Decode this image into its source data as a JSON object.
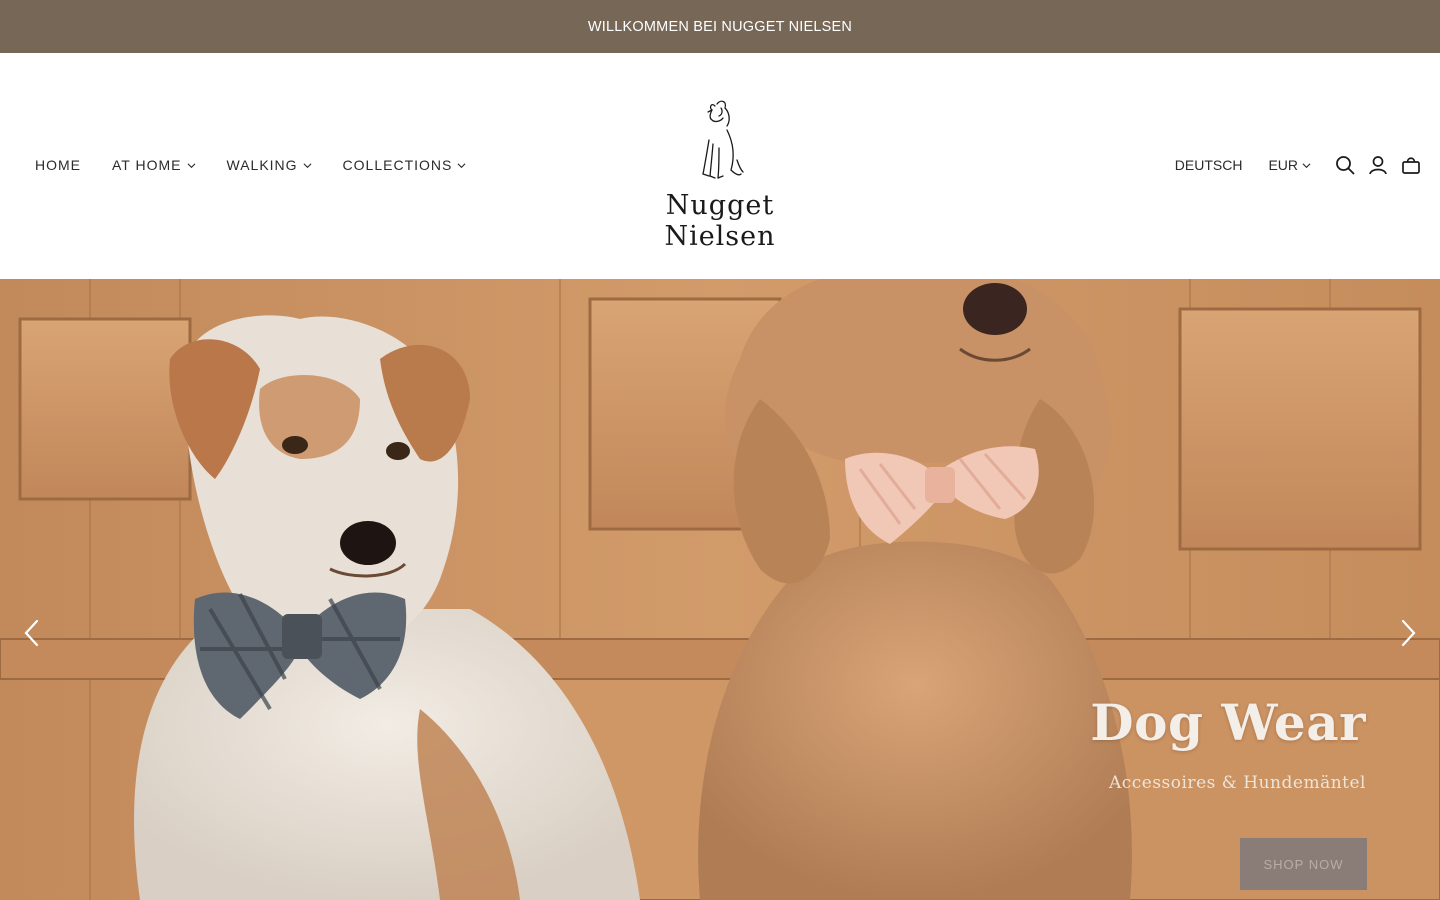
{
  "announcement": {
    "text": "WILLKOMMEN BEI NUGGET NIELSEN"
  },
  "brand": {
    "name": "Nugget Nielsen",
    "logo_icon": "dog-sketch-icon"
  },
  "nav": {
    "items": [
      {
        "label": "HOME",
        "has_dropdown": false
      },
      {
        "label": "AT HOME",
        "has_dropdown": true
      },
      {
        "label": "WALKING",
        "has_dropdown": true
      },
      {
        "label": "COLLECTIONS",
        "has_dropdown": true
      }
    ]
  },
  "utility": {
    "language": "DEUTSCH",
    "currency": "EUR",
    "icons": [
      "search-icon",
      "account-icon",
      "cart-icon"
    ]
  },
  "hero": {
    "title": "Dog Wear",
    "subtitle": "Accessoires & Hundemäntel",
    "cta": "SHOP NOW",
    "prev_icon": "chevron-left-icon",
    "next_icon": "chevron-right-icon"
  },
  "colors": {
    "announcement_bg": "#776757",
    "button_bg": "#8a7c77",
    "wood": "#c98f5e"
  }
}
